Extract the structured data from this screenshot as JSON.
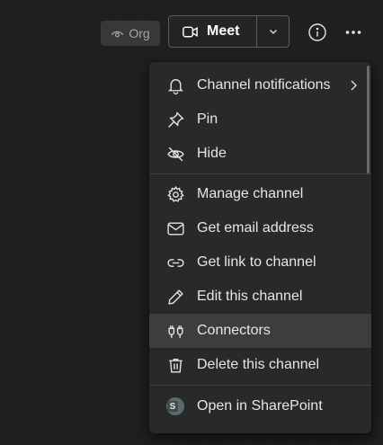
{
  "header": {
    "org_label": "Org",
    "meet_label": "Meet",
    "icons": {
      "org": "eye-icon",
      "meet": "video-camera-icon",
      "meet_caret": "chevron-down-icon",
      "info": "info-icon",
      "more": "more-horizontal-icon"
    }
  },
  "menu": {
    "items": [
      {
        "label": "Channel notifications",
        "icon": "bell-icon",
        "has_submenu": true
      },
      {
        "label": "Pin",
        "icon": "pin-icon"
      },
      {
        "label": "Hide",
        "icon": "eye-off-icon"
      },
      {
        "label": "Manage channel",
        "icon": "gear-icon"
      },
      {
        "label": "Get email address",
        "icon": "mail-icon"
      },
      {
        "label": "Get link to channel",
        "icon": "link-icon"
      },
      {
        "label": "Edit this channel",
        "icon": "pencil-icon"
      },
      {
        "label": "Connectors",
        "icon": "plug-icon",
        "highlighted": true
      },
      {
        "label": "Delete this channel",
        "icon": "trash-icon"
      },
      {
        "label": "Open in SharePoint",
        "icon": "sharepoint-icon"
      }
    ]
  },
  "colors": {
    "background": "#1f1f1f",
    "menu_background": "#292929",
    "highlight": "#3d3d3d",
    "text": "#e6e6e6"
  }
}
